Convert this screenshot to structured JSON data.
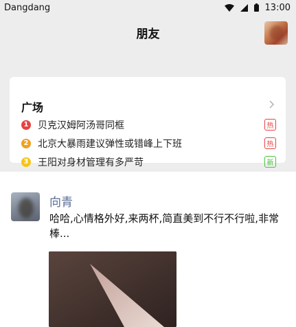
{
  "status_bar": {
    "carrier": "Dangdang",
    "time": "13:00",
    "icons": [
      "wifi-icon",
      "cellular-signal-icon",
      "battery-icon"
    ]
  },
  "top_bar": {
    "title": "朋友"
  },
  "square": {
    "title": "广场",
    "items": [
      {
        "rank": "1",
        "text": "贝克汉姆阿汤哥同框",
        "tag": "热",
        "rank_color": "#e64340",
        "tag_color": "#e64340"
      },
      {
        "rank": "2",
        "text": "北京大暴雨建议弹性或错峰上下班",
        "tag": "热",
        "rank_color": "#f0a020",
        "tag_color": "#e64340"
      },
      {
        "rank": "3",
        "text": "王阳对身材管理有多严苛",
        "tag": "新",
        "rank_color": "#f5c518",
        "tag_color": "#4cc23c"
      }
    ]
  },
  "post": {
    "author": "向青",
    "text": "哈哈,心情格外好,来两杯,简直美到不行不行啦,非常棒..."
  },
  "colors": {
    "background": "#ededed",
    "card": "#ffffff",
    "link": "#576b95"
  }
}
